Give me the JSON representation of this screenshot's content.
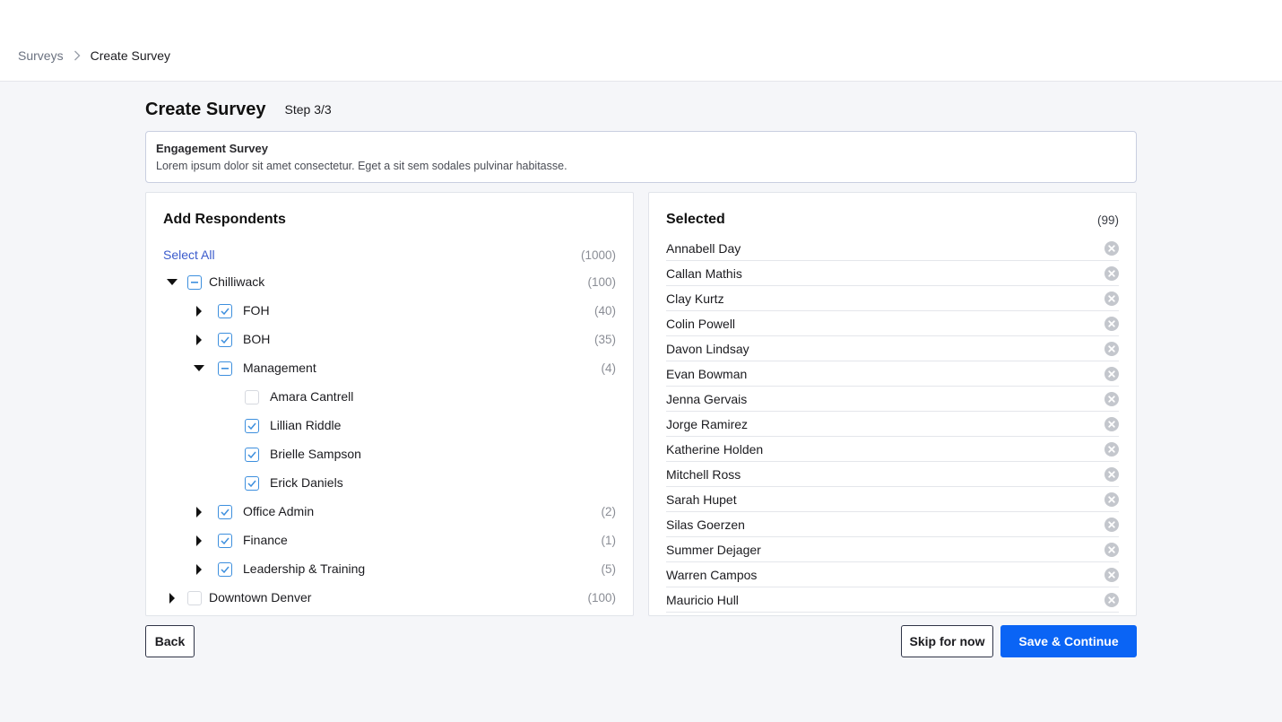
{
  "breadcrumb": {
    "parent": "Surveys",
    "current": "Create Survey"
  },
  "header": {
    "title": "Create Survey",
    "step": "Step 3/3"
  },
  "survey": {
    "name": "Engagement Survey",
    "description": "Lorem ipsum dolor sit amet consectetur. Eget a sit sem sodales pulvinar habitasse."
  },
  "respondents": {
    "title": "Add Respondents",
    "select_all": "Select All",
    "total_count": "(1000)",
    "tree": [
      {
        "label": "Chilliwack",
        "count": "(100)",
        "depth": 0,
        "caret": "down",
        "check": "partial"
      },
      {
        "label": "FOH",
        "count": "(40)",
        "depth": 1,
        "caret": "right",
        "check": "checked"
      },
      {
        "label": "BOH",
        "count": "(35)",
        "depth": 1,
        "caret": "right",
        "check": "checked"
      },
      {
        "label": "Management",
        "count": "(4)",
        "depth": 1,
        "caret": "down",
        "check": "partial"
      },
      {
        "label": "Amara Cantrell",
        "count": "",
        "depth": 2,
        "caret": "none",
        "check": "unchecked"
      },
      {
        "label": "Lillian Riddle",
        "count": "",
        "depth": 2,
        "caret": "none",
        "check": "checked"
      },
      {
        "label": "Brielle Sampson",
        "count": "",
        "depth": 2,
        "caret": "none",
        "check": "checked"
      },
      {
        "label": "Erick Daniels",
        "count": "",
        "depth": 2,
        "caret": "none",
        "check": "checked"
      },
      {
        "label": "Office Admin",
        "count": "(2)",
        "depth": 1,
        "caret": "right",
        "check": "checked"
      },
      {
        "label": "Finance",
        "count": "(1)",
        "depth": 1,
        "caret": "right",
        "check": "checked"
      },
      {
        "label": "Leadership & Training",
        "count": "(5)",
        "depth": 1,
        "caret": "right",
        "check": "checked"
      },
      {
        "label": "Downtown Denver",
        "count": "(100)",
        "depth": 0,
        "caret": "right",
        "check": "unchecked"
      }
    ]
  },
  "selected": {
    "title": "Selected",
    "count": "(99)",
    "people": [
      "Annabell Day",
      "Callan Mathis",
      "Clay Kurtz",
      "Colin Powell",
      "Davon Lindsay",
      "Evan Bowman",
      "Jenna Gervais",
      "Jorge Ramirez",
      "Katherine Holden",
      "Mitchell Ross",
      "Sarah Hupet",
      "Silas Goerzen",
      "Summer Dejager",
      "Warren Campos",
      "Mauricio Hull"
    ]
  },
  "actions": {
    "back": "Back",
    "skip": "Skip for now",
    "save": "Save & Continue"
  },
  "colors": {
    "primary": "#0a64f5",
    "checkbox": "#3d8fde",
    "link": "#3b5bcc"
  }
}
